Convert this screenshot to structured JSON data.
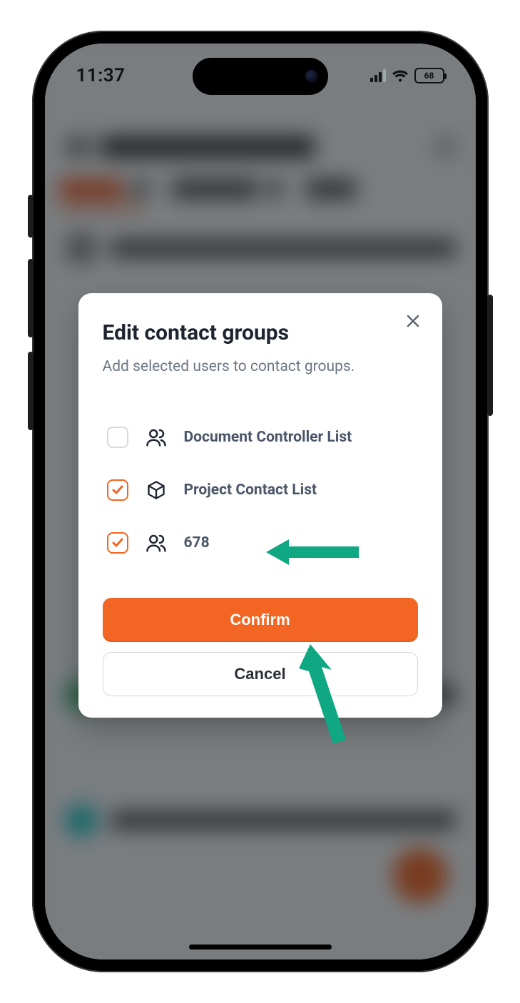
{
  "status_bar": {
    "time": "11:37",
    "battery_text": "68"
  },
  "modal": {
    "title": "Edit contact groups",
    "subtitle": "Add selected users to contact groups.",
    "groups": [
      {
        "label": "Document Controller List",
        "checked": false,
        "icon": "users"
      },
      {
        "label": "Project Contact List",
        "checked": true,
        "icon": "cube"
      },
      {
        "label": "678",
        "checked": true,
        "icon": "users"
      }
    ],
    "confirm_label": "Confirm",
    "cancel_label": "Cancel"
  },
  "colors": {
    "accent": "#f26522",
    "annotation": "#10a882"
  }
}
